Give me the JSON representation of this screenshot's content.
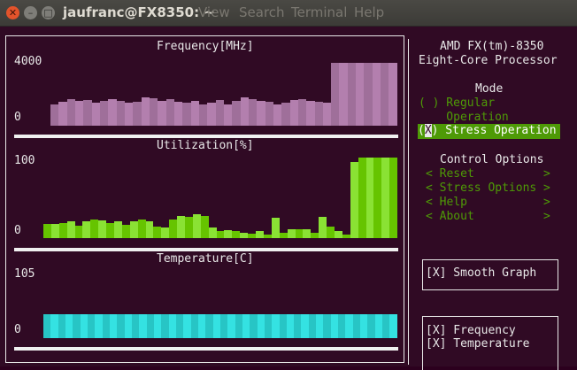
{
  "window": {
    "title": "jaufranc@FX8350: ~",
    "menu": [
      "View",
      "Search",
      "Terminal",
      "Help"
    ],
    "controls": [
      "close",
      "minimize",
      "maximize"
    ]
  },
  "graphs": {
    "frequency": {
      "title": "Frequency[MHz]",
      "max_label": "4000",
      "min_label": "0",
      "color_a": "#9f6f9a",
      "color_b": "#b37fae",
      "values": [
        1200,
        1350,
        1500,
        1400,
        1450,
        1300,
        1380,
        1500,
        1400,
        1300,
        1350,
        1600,
        1550,
        1400,
        1500,
        1350,
        1300,
        1400,
        1200,
        1300,
        1450,
        1200,
        1400,
        1600,
        1500,
        1400,
        1350,
        1200,
        1300,
        1450,
        1500,
        1400,
        1350,
        1300,
        3500,
        3500,
        3500,
        3500,
        3500,
        3500,
        3500,
        3500
      ]
    },
    "utilization": {
      "title": "Utilization[%]",
      "max_label": "100",
      "min_label": "0",
      "color_a": "#66c400",
      "color_b": "#8ae234",
      "values": [
        17,
        17,
        18,
        20,
        15,
        20,
        22,
        21,
        18,
        20,
        16,
        20,
        22,
        20,
        14,
        12,
        22,
        26,
        25,
        28,
        26,
        12,
        8,
        9,
        8,
        6,
        5,
        8,
        4,
        24,
        6,
        10,
        10,
        10,
        6,
        25,
        14,
        8,
        4,
        90,
        95,
        95,
        95,
        95,
        95
      ]
    },
    "temperature": {
      "title": "Temperature[C]",
      "max_label": "105",
      "min_label": "0",
      "color_a": "#27c5c5",
      "color_b": "#34e2e2",
      "values": [
        35,
        35,
        35,
        35,
        35,
        35,
        35,
        35,
        35,
        35,
        35,
        35,
        35,
        35,
        35,
        35,
        35,
        35,
        35,
        35,
        35,
        35,
        35,
        35,
        35,
        35,
        35,
        35,
        35,
        35,
        35,
        35,
        35,
        35,
        35,
        35,
        35,
        35,
        35,
        35,
        35,
        35,
        35,
        35,
        35,
        35,
        35,
        35
      ]
    }
  },
  "side": {
    "cpu_line1": "AMD FX(tm)-8350",
    "cpu_line2": "Eight-Core Processor",
    "mode_title": "Mode",
    "mode_regular_1": "( ) Regular",
    "mode_regular_2": "    Operation",
    "mode_stress_mark": "X",
    "mode_stress_open": "(",
    "mode_stress_rest": ") Stress Operation",
    "control_title": "Control Options",
    "controls": [
      "< Reset          >",
      "< Stress Options >",
      "< Help           >",
      "< About          >"
    ],
    "smooth": "[X] Smooth Graph",
    "show_frequency": "[X] Frequency",
    "show_temperature": "[X] Temperature"
  },
  "colors": {
    "highlight": "#4e9a06",
    "cursor": "#e8e8e8",
    "text": "#e8e8e8"
  }
}
